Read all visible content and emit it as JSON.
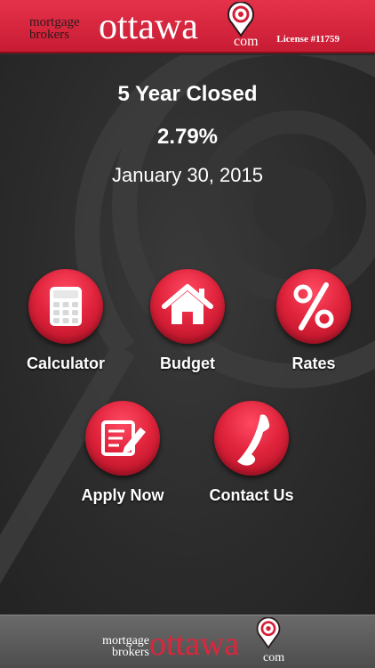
{
  "header": {
    "logo": {
      "mortgage": "mortgage",
      "brokers": "brokers",
      "ottawa": "ottawa",
      "com": "com"
    },
    "license": "License #11759"
  },
  "rate": {
    "title": "5 Year Closed",
    "value": "2.79%",
    "date": "January 30, 2015"
  },
  "tiles": [
    {
      "label": "Calculator",
      "icon": "calculator-icon"
    },
    {
      "label": "Budget",
      "icon": "house-icon"
    },
    {
      "label": "Rates",
      "icon": "percent-icon"
    },
    {
      "label": "Apply Now",
      "icon": "form-pencil-icon"
    },
    {
      "label": "Contact Us",
      "icon": "phone-icon"
    }
  ],
  "footer": {
    "logo": {
      "mortgage": "mortgage",
      "brokers": "brokers",
      "ottawa": "ottawa",
      "com": "com"
    }
  },
  "colors": {
    "brand_red": "#e0243c",
    "background": "#2a2a2a",
    "footer": "#5a5a5a"
  }
}
